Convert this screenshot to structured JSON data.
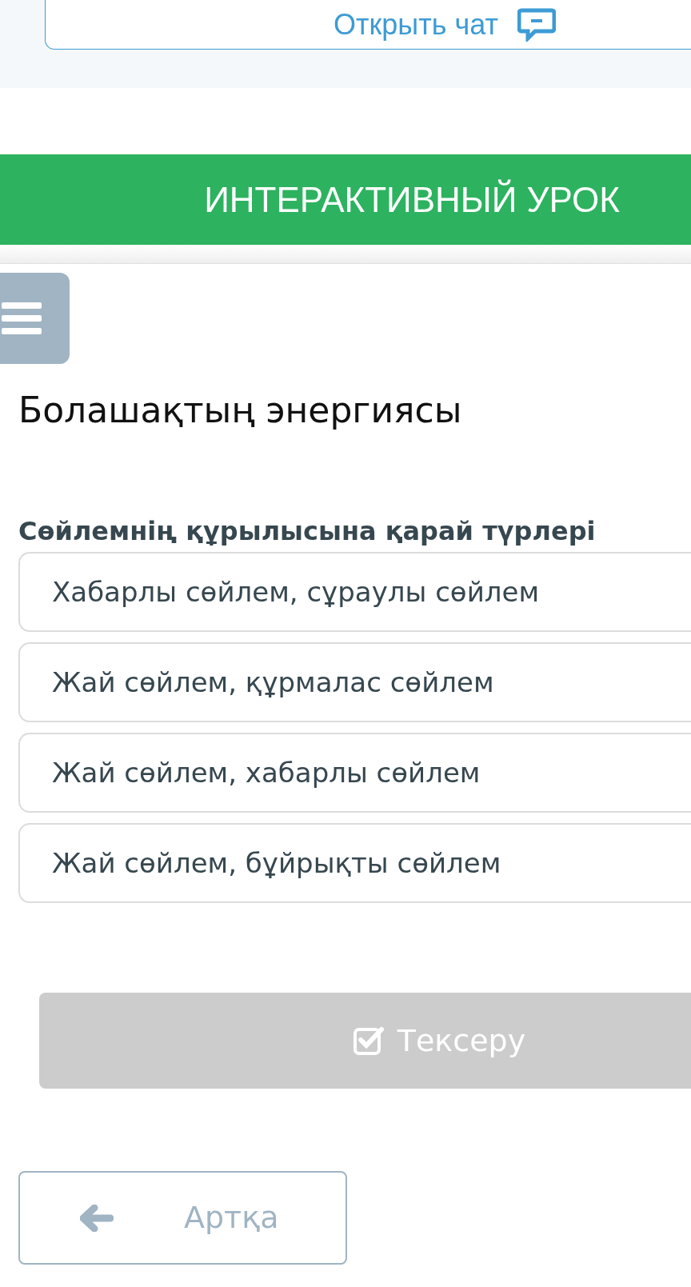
{
  "chat_button": {
    "label": "Открыть чат"
  },
  "banner": {
    "title": "ИНТЕРАКТИВНЫЙ УРОК"
  },
  "lesson_title": "Болашақтың энергиясы",
  "question": "Сөйлемнің құрылысына қарай түрлері",
  "options": [
    {
      "label": "Хабарлы сөйлем, сұраулы сөйлем",
      "selected": false
    },
    {
      "label": "Жай сөйлем, құрмалас сөйлем",
      "selected": false
    },
    {
      "label": "Жай сөйлем, хабарлы сөйлем",
      "selected": false
    },
    {
      "label": "Жай сөйлем, бұйрықты сөйлем",
      "selected": false
    }
  ],
  "check_button": {
    "label": "Тексеру",
    "disabled": true
  },
  "back_button": {
    "label": "Артқа"
  }
}
